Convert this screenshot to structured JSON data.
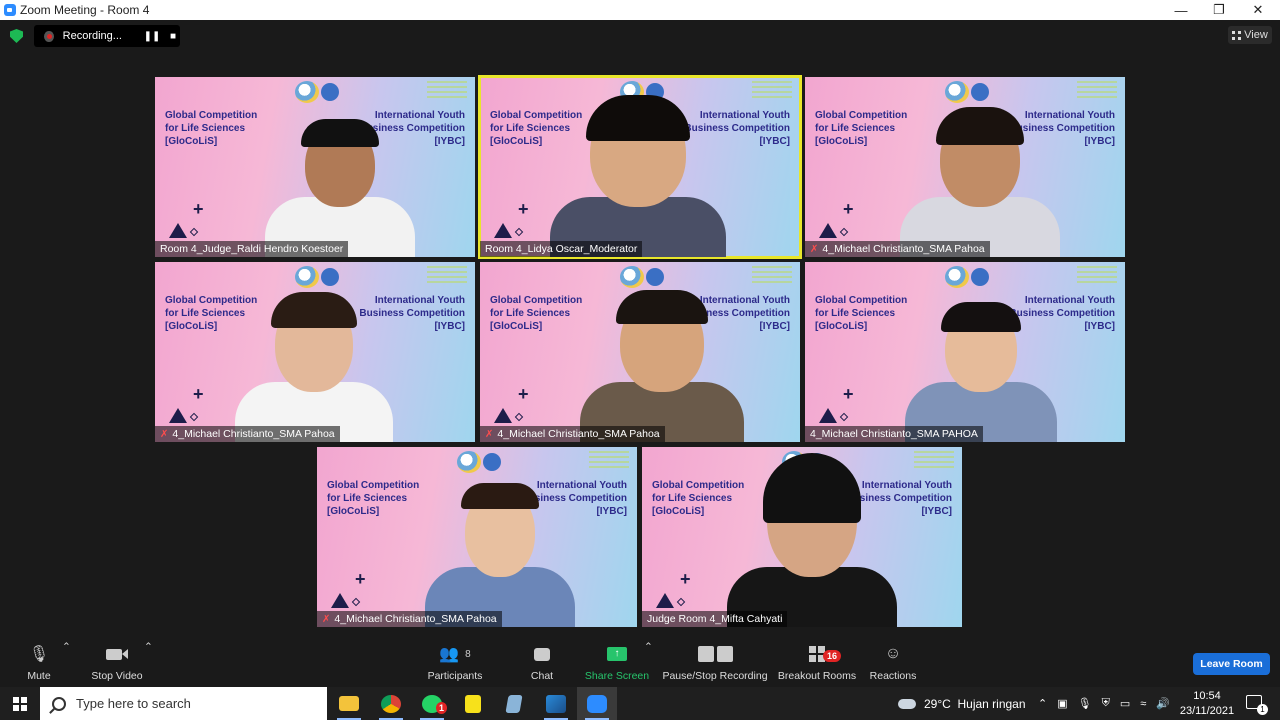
{
  "window": {
    "title": "Zoom Meeting - Room 4",
    "controls": [
      "minimize-icon",
      "maximize-icon",
      "close-icon"
    ]
  },
  "recording": {
    "label": "Recording...",
    "pause_icon": "pause-icon",
    "stop_icon": "stop-icon"
  },
  "view_button": "View",
  "slide": {
    "left_title": "Global Competition\nfor Life Sciences\n[GloCoLiS]",
    "right_title": "International Youth\nBusiness Competition\n[IYBC]",
    "logo_text": "GloCoLiS"
  },
  "participants": [
    {
      "name": "Room 4_Judge_Raldi Hendro Koestoer",
      "muted": false,
      "active": false
    },
    {
      "name": "Room 4_Lidya Oscar_Moderator",
      "muted": false,
      "active": true
    },
    {
      "name": "4_Michael Christianto_SMA Pahoa",
      "muted": true,
      "active": false
    },
    {
      "name": "4_Michael Christianto_SMA Pahoa",
      "muted": true,
      "active": false
    },
    {
      "name": "4_Michael Christianto_SMA Pahoa",
      "muted": true,
      "active": false
    },
    {
      "name": "4_Michael Christianto_SMA PAHOA",
      "muted": false,
      "active": false
    },
    {
      "name": "4_Michael Christianto_SMA Pahoa",
      "muted": true,
      "active": false
    },
    {
      "name": "Judge Room 4_Mifta Cahyati",
      "muted": false,
      "active": false
    }
  ],
  "toolbar": {
    "mute": "Mute",
    "stop_video": "Stop Video",
    "participants": "Participants",
    "participants_count": "8",
    "chat": "Chat",
    "share_screen": "Share Screen",
    "pause_stop_recording": "Pause/Stop Recording",
    "breakout_rooms": "Breakout Rooms",
    "breakout_count": "16",
    "reactions": "Reactions",
    "leave": "Leave Room"
  },
  "taskbar": {
    "search_placeholder": "Type here to search",
    "apps": [
      "file-explorer-icon",
      "chrome-icon",
      "whatsapp-icon",
      "sticky-notes-icon",
      "app-icon",
      "photos-icon",
      "zoom-icon"
    ],
    "whatsapp_badge": "1",
    "weather": "29°C  Hujan ringan",
    "time": "10:54",
    "date": "23/11/2021",
    "notifications": "1"
  },
  "colors": {
    "active_speaker": "#e8e62a",
    "share_green": "#27c46c",
    "leave_blue": "#1a6ed8",
    "badge_red": "#e02424"
  }
}
